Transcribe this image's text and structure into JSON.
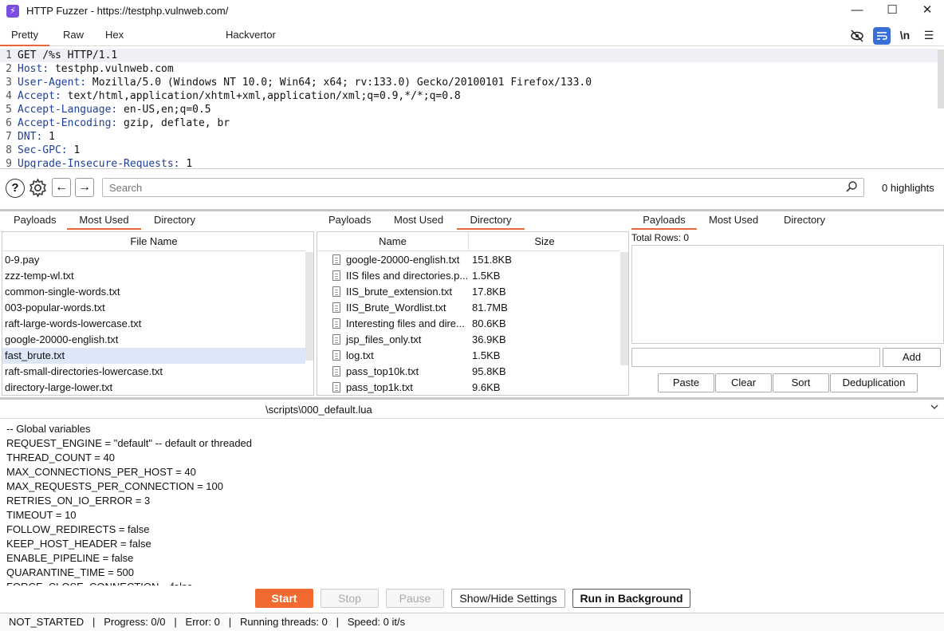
{
  "window": {
    "title": "HTTP Fuzzer - https://testphp.vulnweb.com/",
    "controls": {
      "minimize": "—",
      "maximize": "☐",
      "close": "✕"
    }
  },
  "editor_tabs": [
    "Pretty",
    "Raw",
    "Hex",
    "Hackvertor"
  ],
  "editor_tools": {
    "wrap_label": "\\n"
  },
  "request_lines": [
    {
      "num": "1",
      "name": "",
      "value": "GET /%s HTTP/1.1"
    },
    {
      "num": "2",
      "name": "Host",
      "value": " testphp.vulnweb.com"
    },
    {
      "num": "3",
      "name": "User-Agent",
      "value": " Mozilla/5.0 (Windows NT 10.0; Win64; x64; rv:133.0) Gecko/20100101 Firefox/133.0"
    },
    {
      "num": "4",
      "name": "Accept",
      "value": " text/html,application/xhtml+xml,application/xml;q=0.9,*/*;q=0.8"
    },
    {
      "num": "5",
      "name": "Accept-Language",
      "value": " en-US,en;q=0.5"
    },
    {
      "num": "6",
      "name": "Accept-Encoding",
      "value": " gzip, deflate, br"
    },
    {
      "num": "7",
      "name": "DNT",
      "value": " 1"
    },
    {
      "num": "8",
      "name": "Sec-GPC",
      "value": " 1"
    },
    {
      "num": "9",
      "name": "Upgrade-Insecure-Requests",
      "value": " 1"
    }
  ],
  "search": {
    "placeholder": "Search",
    "highlights": "0 highlights"
  },
  "panel_tabs": [
    "Payloads",
    "Most Used",
    "Directory"
  ],
  "left_panel": {
    "header": "File Name",
    "files": [
      "0-9.pay",
      "zzz-temp-wl.txt",
      "common-single-words.txt",
      "003-popular-words.txt",
      "raft-large-words-lowercase.txt",
      "google-20000-english.txt",
      "fast_brute.txt",
      "raft-small-directories-lowercase.txt",
      "directory-large-lower.txt"
    ],
    "selected_index": 6
  },
  "middle_panel": {
    "headers": [
      "Name",
      "Size"
    ],
    "files": [
      {
        "name": "google-20000-english.txt",
        "size": "151.8KB"
      },
      {
        "name": "IIS files and directories.p...",
        "size": "1.5KB"
      },
      {
        "name": "IIS_brute_extension.txt",
        "size": "17.8KB"
      },
      {
        "name": "IIS_Brute_Wordlist.txt",
        "size": "81.7MB"
      },
      {
        "name": "Interesting files and dire...",
        "size": "80.6KB"
      },
      {
        "name": "jsp_files_only.txt",
        "size": "36.9KB"
      },
      {
        "name": "log.txt",
        "size": "1.5KB"
      },
      {
        "name": "pass_top10k.txt",
        "size": "95.8KB"
      },
      {
        "name": "pass_top1k.txt",
        "size": "9.6KB"
      }
    ]
  },
  "right_panel": {
    "total_rows": "Total Rows: 0",
    "add_label": "Add",
    "buttons": [
      "Paste",
      "Clear",
      "Sort",
      "Deduplication"
    ]
  },
  "script": {
    "path": "\\scripts\\000_default.lua",
    "lines": [
      "-- Global variables",
      "REQUEST_ENGINE = \"default\" -- default or threaded",
      "THREAD_COUNT = 40",
      "MAX_CONNECTIONS_PER_HOST = 40",
      "MAX_REQUESTS_PER_CONNECTION = 100",
      "RETRIES_ON_IO_ERROR = 3",
      "TIMEOUT = 10",
      "FOLLOW_REDIRECTS = false",
      "KEEP_HOST_HEADER = false",
      "ENABLE_PIPELINE = false",
      "QUARANTINE_TIME = 500",
      "FORCE_CLOSE_CONNECTION = false"
    ]
  },
  "controls": {
    "start": "Start",
    "stop": "Stop",
    "pause": "Pause",
    "show_hide": "Show/Hide Settings",
    "run_bg": "Run in Background"
  },
  "status": "NOT_STARTED   |   Progress: 0/0   |   Error: 0   |   Running threads: 0   |   Speed: 0 it/s",
  "colors": {
    "accent": "#f26a2f",
    "header_blue": "#1f3f9a",
    "selection": "#dde7f7"
  }
}
